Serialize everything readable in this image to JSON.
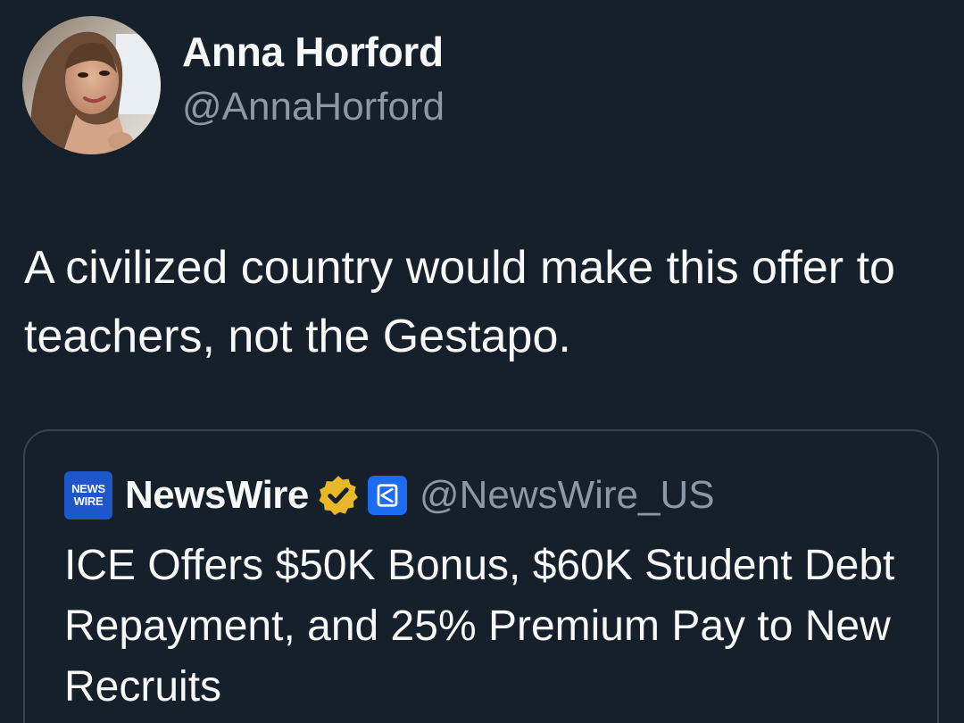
{
  "tweet": {
    "author": {
      "display_name": "Anna Horford",
      "handle": "@AnnaHorford"
    },
    "text": "A civilized country would make this offer to teachers, not the Gestapo."
  },
  "quoted_tweet": {
    "logo_text_top": "NEWS",
    "logo_text_bottom": "WIRE",
    "display_name": "NewsWire",
    "handle": "@NewsWire_US",
    "text": "ICE Offers $50K Bonus, $60K Student Debt Repayment, and 25% Premium Pay to New Recruits",
    "verified_icon": "gold-verified-badge-icon",
    "affiliate_icon": "affiliate-badge-icon"
  },
  "colors": {
    "background": "#15202b",
    "text_primary": "#f7f9f9",
    "text_secondary": "#8b98a5",
    "border": "#38444d",
    "verified_gold": "#e8b829",
    "logo_blue": "#1e57c9",
    "affiliate_blue": "#1d6bf2"
  }
}
